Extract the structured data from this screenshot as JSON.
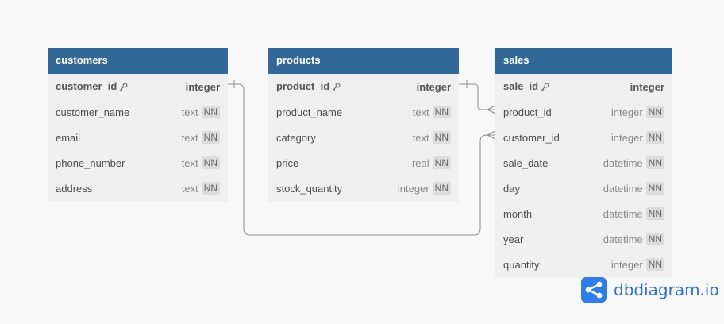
{
  "tables": [
    {
      "name": "customers",
      "fields": [
        {
          "name": "customer_id",
          "type": "integer",
          "pk": true,
          "nn": false
        },
        {
          "name": "customer_name",
          "type": "text",
          "pk": false,
          "nn": true
        },
        {
          "name": "email",
          "type": "text",
          "pk": false,
          "nn": true
        },
        {
          "name": "phone_number",
          "type": "text",
          "pk": false,
          "nn": true
        },
        {
          "name": "address",
          "type": "text",
          "pk": false,
          "nn": true
        }
      ]
    },
    {
      "name": "products",
      "fields": [
        {
          "name": "product_id",
          "type": "integer",
          "pk": true,
          "nn": false
        },
        {
          "name": "product_name",
          "type": "text",
          "pk": false,
          "nn": true
        },
        {
          "name": "category",
          "type": "text",
          "pk": false,
          "nn": true
        },
        {
          "name": "price",
          "type": "real",
          "pk": false,
          "nn": true
        },
        {
          "name": "stock_quantity",
          "type": "integer",
          "pk": false,
          "nn": true
        }
      ]
    },
    {
      "name": "sales",
      "fields": [
        {
          "name": "sale_id",
          "type": "integer",
          "pk": true,
          "nn": false
        },
        {
          "name": "product_id",
          "type": "integer",
          "pk": false,
          "nn": true
        },
        {
          "name": "customer_id",
          "type": "integer",
          "pk": false,
          "nn": true
        },
        {
          "name": "sale_date",
          "type": "datetime",
          "pk": false,
          "nn": true
        },
        {
          "name": "day",
          "type": "datetime",
          "pk": false,
          "nn": true
        },
        {
          "name": "month",
          "type": "datetime",
          "pk": false,
          "nn": true
        },
        {
          "name": "year",
          "type": "datetime",
          "pk": false,
          "nn": true
        },
        {
          "name": "quantity",
          "type": "integer",
          "pk": false,
          "nn": true
        }
      ]
    }
  ],
  "nn_label": "NN",
  "brand": {
    "name": "dbdiagram.io",
    "color": "#2f7ee8"
  },
  "colors": {
    "header": "#316896",
    "body": "#efefef",
    "canvas": "#f8f8f9",
    "connector": "#8c8c8c"
  }
}
